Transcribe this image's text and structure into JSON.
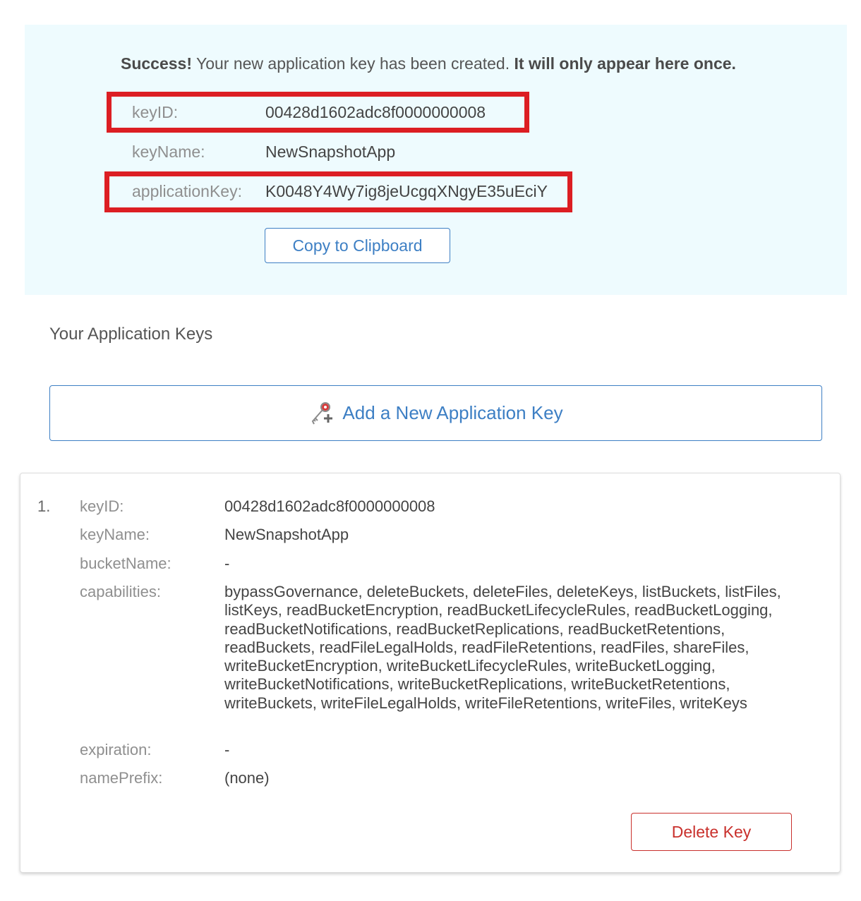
{
  "success": {
    "prefix": "Success!",
    "message": " Your new application key has been created. ",
    "emphasis": "It will only appear here once.",
    "fields": {
      "keyID": {
        "label": "keyID:",
        "value": "00428d1602adc8f0000000008"
      },
      "keyName": {
        "label": "keyName:",
        "value": "NewSnapshotApp"
      },
      "applicationKey": {
        "label": "applicationKey:",
        "value": "K0048Y4Wy7ig8jeUcgqXNgyE35uEciY"
      }
    },
    "copy_label": "Copy to Clipboard"
  },
  "keys_section": {
    "title": "Your Application Keys",
    "add_label": "Add a New Application Key"
  },
  "key_list": [
    {
      "index": "1.",
      "keyID": {
        "label": "keyID:",
        "value": "00428d1602adc8f0000000008"
      },
      "keyName": {
        "label": "keyName:",
        "value": "NewSnapshotApp"
      },
      "bucketName": {
        "label": "bucketName:",
        "value": "-"
      },
      "capabilities": {
        "label": "capabilities:",
        "value": "bypassGovernance, deleteBuckets, deleteFiles, deleteKeys, listBuckets, listFiles, listKeys, readBucketEncryption, readBucketLifecycleRules, readBucketLogging, readBucketNotifications, readBucketReplications, readBucketRetentions, readBuckets, readFileLegalHolds, readFileRetentions, readFiles, shareFiles, writeBucketEncryption, writeBucketLifecycleRules, writeBucketLogging, writeBucketNotifications, writeBucketReplications, writeBucketRetentions, writeBuckets, writeFileLegalHolds, writeFileRetentions, writeFiles, writeKeys"
      },
      "expiration": {
        "label": "expiration:",
        "value": "-"
      },
      "namePrefix": {
        "label": "namePrefix:",
        "value": "(none)"
      },
      "delete_label": "Delete Key"
    }
  ],
  "colors": {
    "panel_bg": "#eefbfe",
    "accent_blue": "#3d7fc4",
    "highlight_red": "#dc1e23",
    "danger_red": "#c9302c"
  },
  "icons": {
    "add_key": "key-add-icon"
  }
}
